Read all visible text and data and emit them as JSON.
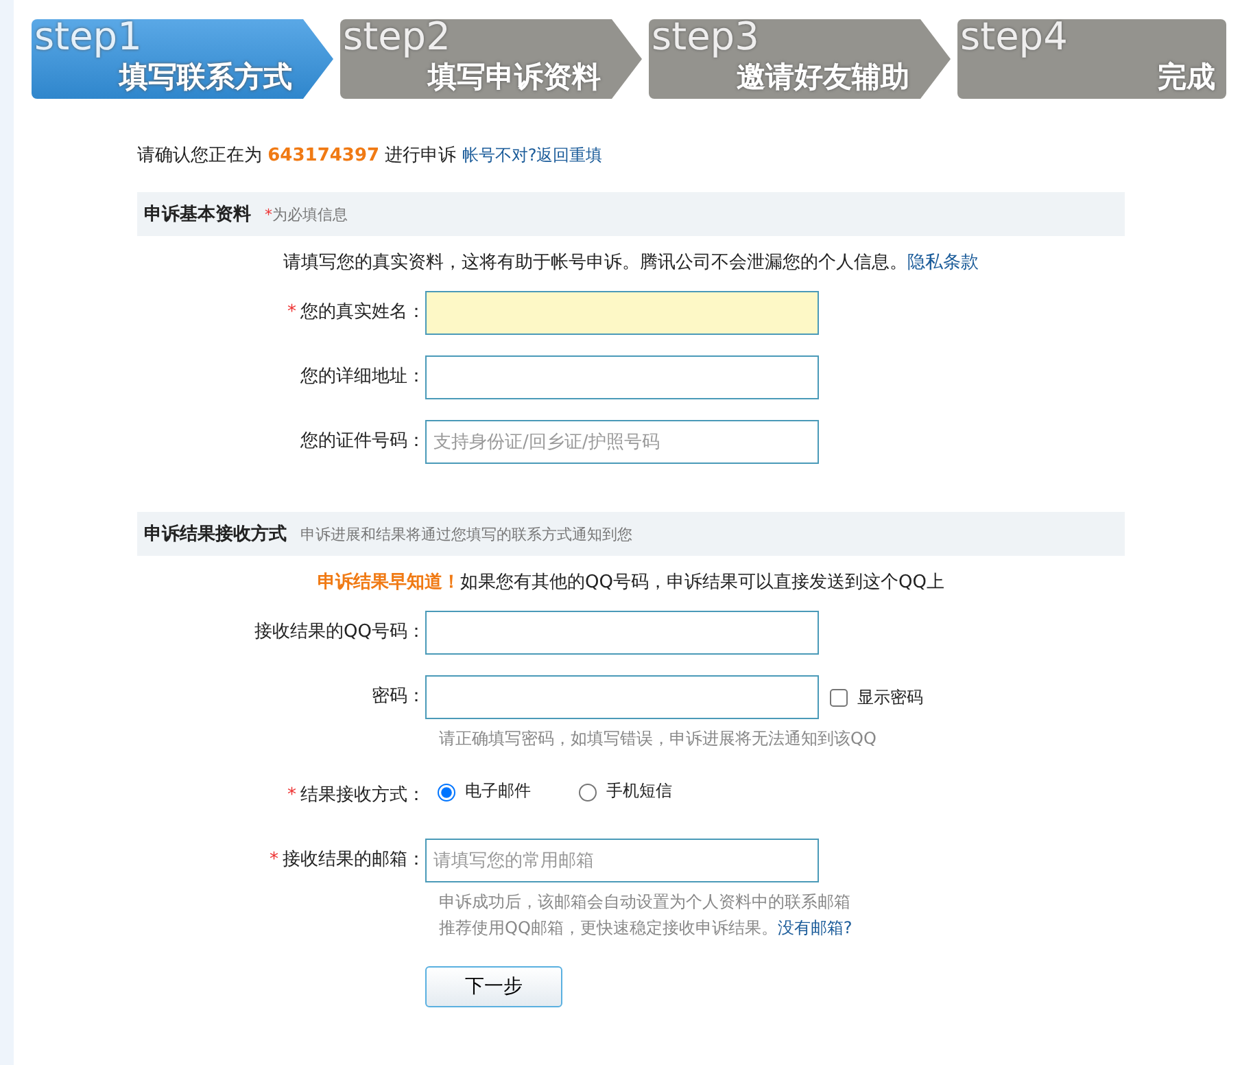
{
  "steps": [
    {
      "step": "step1",
      "label": "填写联系方式",
      "selected": true
    },
    {
      "step": "step2",
      "label": "填写申诉资料",
      "selected": false
    },
    {
      "step": "step3",
      "label": "邀请好友辅助",
      "selected": false
    },
    {
      "step": "step4",
      "label": "完成",
      "selected": false
    }
  ],
  "confirm": {
    "prefix": "请确认您正在为",
    "account": "643174397",
    "suffix": "进行申诉",
    "links": [
      "帐号不对?",
      "返回重填"
    ]
  },
  "sections": [
    {
      "title": "申诉基本资料",
      "note_mark": "*",
      "note": "为必填信息",
      "intro": {
        "text": "请填写您的真实资料，这将有助于帐号申诉。腾讯公司不会泄漏您的个人信息。",
        "link": "隐私条款"
      },
      "fields": [
        {
          "kind": "text",
          "required": true,
          "label": "您的真实姓名：",
          "focused": true
        },
        {
          "kind": "text",
          "required": false,
          "label": "您的详细地址：",
          "focused": false
        },
        {
          "kind": "text",
          "required": false,
          "label": "您的证件号码：",
          "placeholder": "支持身份证/回乡证/护照号码",
          "focused": false
        }
      ]
    },
    {
      "title": "申诉结果接收方式",
      "note": "申诉进展和结果将通过您填写的联系方式通知到您",
      "intro": {
        "highlight": "申诉结果早知道！",
        "text": "如果您有其他的QQ号码，申诉结果可以直接发送到这个QQ上"
      },
      "fields": [
        {
          "kind": "text",
          "required": false,
          "label": "接收结果的QQ号码：",
          "focused": false
        },
        {
          "kind": "password",
          "required": false,
          "label": "密码：",
          "focused": false,
          "checkbox": {
            "label": "显示密码",
            "checked": false
          },
          "hints": [
            {
              "text": "请正确填写密码，如填写错误，申诉进展将无法通知到该QQ"
            }
          ]
        },
        {
          "kind": "radio",
          "required": true,
          "label": "结果接收方式：",
          "options": [
            {
              "label": "电子邮件",
              "selected": true
            },
            {
              "label": "手机短信",
              "selected": false
            }
          ]
        },
        {
          "kind": "text",
          "required": true,
          "label": "接收结果的邮箱：",
          "placeholder": "请填写您的常用邮箱",
          "focused": false,
          "hints": [
            {
              "text": "申诉成功后，该邮箱会自动设置为个人资料中的联系邮箱"
            },
            {
              "text": "推荐使用QQ邮箱，更快速稳定接收申诉结果。",
              "link": "没有邮箱?"
            }
          ]
        }
      ]
    }
  ],
  "submit": "下一步"
}
